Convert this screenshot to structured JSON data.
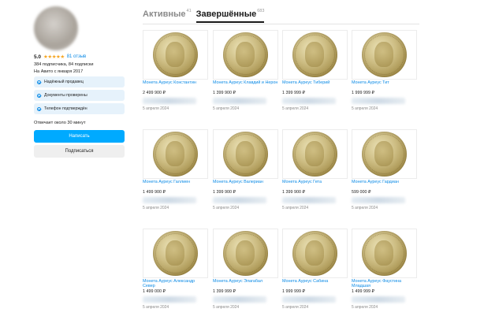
{
  "profile": {
    "rating": "5.0",
    "stars": "★★★★★",
    "reviews": "81 отзыв",
    "subs": "384 подписчика, 84 подписки",
    "since": "На Авито с января 2017",
    "badges": [
      "Надёжный продавец",
      "Документы проверены",
      "Телефон подтверждён"
    ],
    "reply": "Отвечает около 30 минут",
    "write_btn": "Написать",
    "subscribe_btn": "Подписаться"
  },
  "tabs": [
    {
      "label": "Активные",
      "count": "41"
    },
    {
      "label": "Завершённые",
      "count": "683"
    }
  ],
  "colors": {
    "accent": "#00aaff",
    "link": "#0a8ae6",
    "star": "#f5a623"
  },
  "items": [
    {
      "title": "Монета Ауреус Константин",
      "price": "2 499 900 ₽",
      "date": "5 апреля 2024"
    },
    {
      "title": "Монета Ауреус Клавдий и Нерон",
      "price": "1 399 900 ₽",
      "date": "5 апреля 2024"
    },
    {
      "title": "Монета Ауреус Тиберий",
      "price": "1 399 999 ₽",
      "date": "5 апреля 2024"
    },
    {
      "title": "Монета Ауреус Тит",
      "price": "1 999 999 ₽",
      "date": "5 апреля 2024"
    },
    {
      "title": "Монета Ауреус Галлиен",
      "price": "1 499 900 ₽",
      "date": "5 апреля 2024"
    },
    {
      "title": "Монета Ауреус Валериан",
      "price": "1 399 900 ₽",
      "date": "5 апреля 2024"
    },
    {
      "title": "Монета Ауреус Гета",
      "price": "1 399 900 ₽",
      "date": "5 апреля 2024"
    },
    {
      "title": "Монета Ауреус Гардиан",
      "price": "599 000 ₽",
      "date": "5 апреля 2024"
    },
    {
      "title": "Монета Ауреус Александр Север",
      "price": "1 499 000 ₽",
      "date": "5 апреля 2024"
    },
    {
      "title": "Монета Ауреус Элагабал",
      "price": "1 399 999 ₽",
      "date": "5 апреля 2024"
    },
    {
      "title": "Монета Ауреус Сабина",
      "price": "1 999 999 ₽",
      "date": "5 апреля 2024"
    },
    {
      "title": "Монета Ауреус Фаустина Младшая",
      "price": "1 499 999 ₽",
      "date": "5 апреля 2024"
    }
  ]
}
